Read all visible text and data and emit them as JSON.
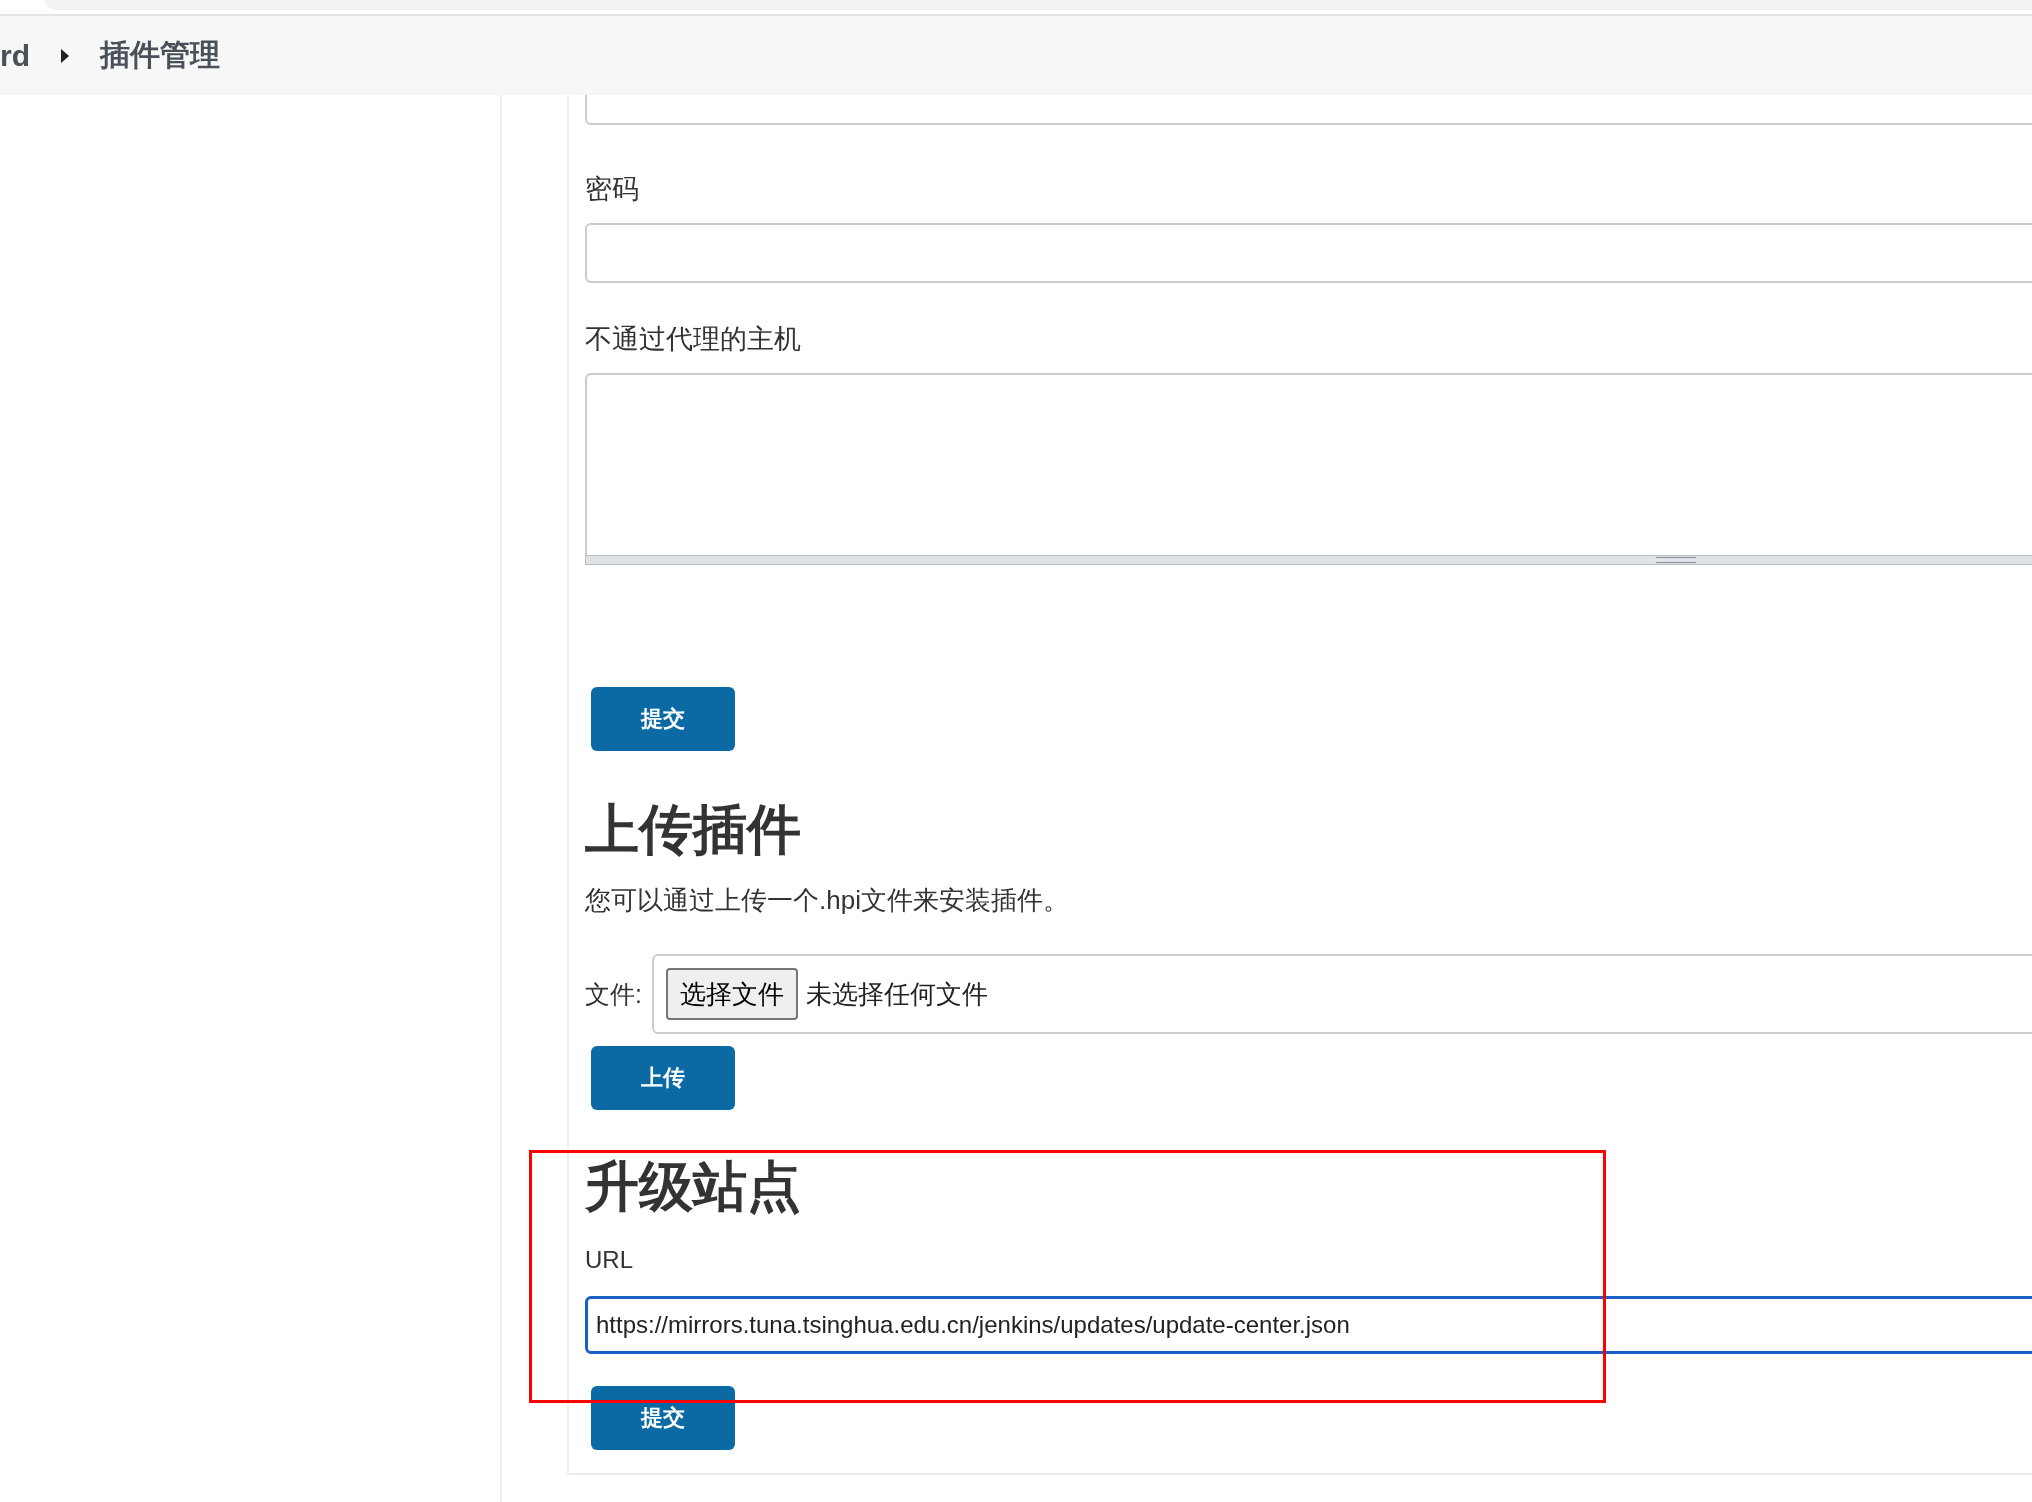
{
  "breadcrumb": {
    "items": [
      {
        "label": "rd"
      },
      {
        "label": "插件管理"
      }
    ]
  },
  "proxy_form": {
    "password_label": "密码",
    "no_proxy_label": "不通过代理的主机",
    "submit": "提交"
  },
  "upload": {
    "heading": "上传插件",
    "description": "您可以通过上传一个.hpi文件来安装插件。",
    "file_label": "文件:",
    "choose_button": "选择文件",
    "file_status": "未选择任何文件",
    "submit": "上传"
  },
  "update_site": {
    "heading": "升级站点",
    "url_label": "URL",
    "url_value": "https://mirrors.tuna.tsinghua.edu.cn/jenkins/updates/update-center.json",
    "submit": "提交"
  }
}
